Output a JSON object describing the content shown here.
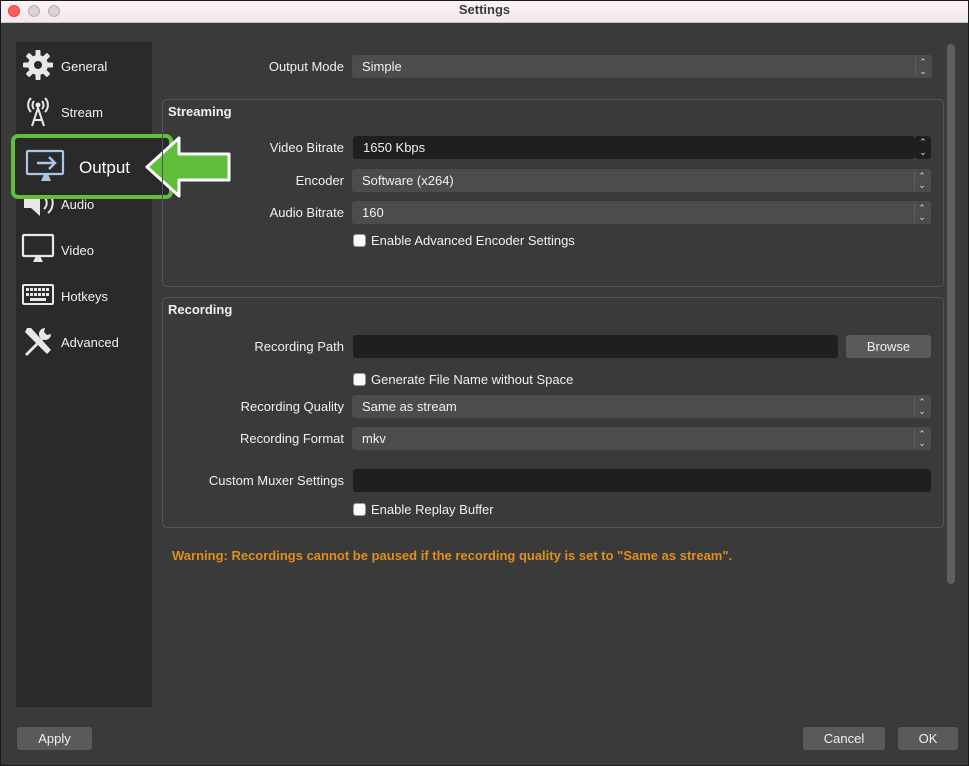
{
  "window": {
    "title": "Settings"
  },
  "sidebar": {
    "items": [
      {
        "label": "General",
        "icon": "gear-icon"
      },
      {
        "label": "Stream",
        "icon": "broadcast-antenna-icon"
      },
      {
        "label": "Output",
        "icon": "output-monitor-arrow-icon",
        "selected": true
      },
      {
        "label": "Audio",
        "icon": "speaker-icon"
      },
      {
        "label": "Video",
        "icon": "monitor-icon"
      },
      {
        "label": "Hotkeys",
        "icon": "keyboard-icon"
      },
      {
        "label": "Advanced",
        "icon": "tools-icon"
      }
    ]
  },
  "output_mode": {
    "label": "Output Mode",
    "value": "Simple"
  },
  "streaming": {
    "title": "Streaming",
    "video_bitrate": {
      "label": "Video Bitrate",
      "value": "1650 Kbps"
    },
    "encoder": {
      "label": "Encoder",
      "value": "Software (x264)"
    },
    "audio_bitrate": {
      "label": "Audio Bitrate",
      "value": "160"
    },
    "advanced_encoder": {
      "label": "Enable Advanced Encoder Settings",
      "checked": false
    }
  },
  "recording": {
    "title": "Recording",
    "path": {
      "label": "Recording Path",
      "value": ""
    },
    "browse_label": "Browse",
    "no_space": {
      "label": "Generate File Name without Space",
      "checked": false
    },
    "quality": {
      "label": "Recording Quality",
      "value": "Same as stream"
    },
    "format": {
      "label": "Recording Format",
      "value": "mkv"
    },
    "muxer": {
      "label": "Custom Muxer Settings",
      "value": ""
    },
    "replay_buffer": {
      "label": "Enable Replay Buffer",
      "checked": false
    }
  },
  "warning": "Warning: Recordings cannot be paused if the recording quality is set to \"Same as stream\".",
  "footer": {
    "apply": "Apply",
    "cancel": "Cancel",
    "ok": "OK"
  },
  "colors": {
    "accent_highlight": "#5fbf3a",
    "warning": "#e08f1e",
    "sidebar_bg": "#2a2a2a",
    "panel_bg": "#3a3a3a"
  }
}
